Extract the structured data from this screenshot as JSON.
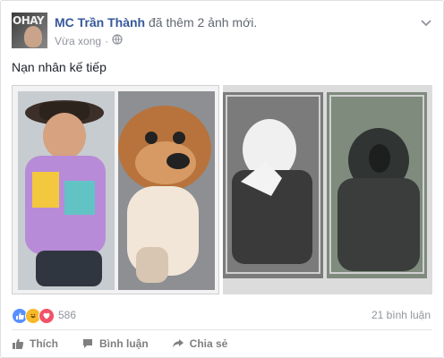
{
  "post": {
    "author": "MC Trần Thành",
    "action_text": "đã thêm 2 ảnh mới.",
    "time": "Vừa xong",
    "separator": "·",
    "privacy_icon": "globe-icon",
    "avatar_overlay_text": "OHAY",
    "text": "Nạn nhân kế tiếp"
  },
  "photos": [
    {
      "description_icon": "man-and-bulldog-photo"
    },
    {
      "description_icon": "man-and-gorilla-photo"
    }
  ],
  "stats": {
    "reactions": [
      "like-icon",
      "haha-icon",
      "love-icon"
    ],
    "reaction_count": "586",
    "comments": "21 bình luận"
  },
  "actions": {
    "like": "Thích",
    "comment": "Bình luận",
    "share": "Chia sẻ"
  },
  "colors": {
    "author": "#365899",
    "meta": "#90949c",
    "like_blue": "#5890ff",
    "haha_yellow": "#f7b928",
    "love_red": "#f25268"
  }
}
